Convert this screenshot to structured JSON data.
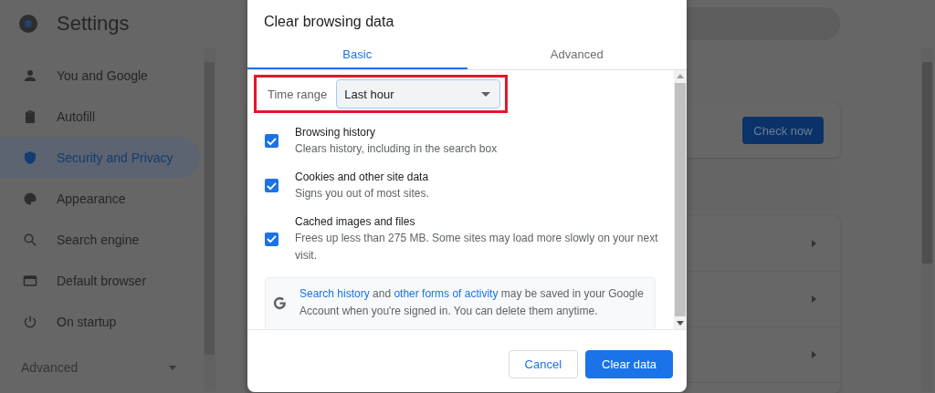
{
  "sidebar": {
    "title": "Settings",
    "items": [
      {
        "label": "You and Google",
        "selected": false
      },
      {
        "label": "Autofill",
        "selected": false
      },
      {
        "label": "Security and Privacy",
        "selected": true
      },
      {
        "label": "Appearance",
        "selected": false
      },
      {
        "label": "Search engine",
        "selected": false
      },
      {
        "label": "Default browser",
        "selected": false
      },
      {
        "label": "On startup",
        "selected": false
      }
    ],
    "advanced": {
      "label": "Advanced",
      "expanded": false
    }
  },
  "page": {
    "check_button": "Check now"
  },
  "dialog": {
    "title": "Clear browsing data",
    "tabs": [
      {
        "label": "Basic",
        "selected": true
      },
      {
        "label": "Advanced",
        "selected": false
      }
    ],
    "time_range": {
      "label": "Time range",
      "value": "Last hour",
      "highlighted": true
    },
    "items": [
      {
        "title": "Browsing history",
        "description": "Clears history, including in the search box",
        "checked": true
      },
      {
        "title": "Cookies and other site data",
        "description": "Signs you out of most sites.",
        "checked": true
      },
      {
        "title": "Cached images and files",
        "description": "Frees up less than 275 MB. Some sites may load more slowly on your next visit.",
        "checked": true
      }
    ],
    "note": [
      {
        "text": "Search history",
        "link": true
      },
      {
        "text": " and ",
        "link": false
      },
      {
        "text": "other forms of activity",
        "link": true
      },
      {
        "text": " may be saved in your Google Account when you're signed in. You can delete them anytime.",
        "link": false
      }
    ],
    "buttons": [
      {
        "label": "Cancel",
        "kind": "secondary"
      },
      {
        "label": "Clear data",
        "kind": "primary"
      }
    ]
  }
}
